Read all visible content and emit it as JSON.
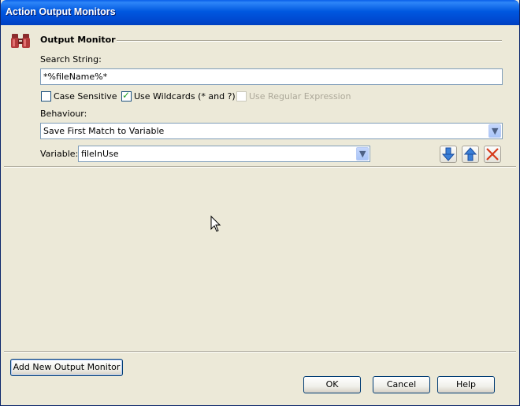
{
  "window": {
    "title": "Action Output Monitors",
    "titlebar_color": "#0054E3",
    "background": "#ECE9D8"
  },
  "section": {
    "title": "Output Monitor",
    "icon": "binoculars-icon"
  },
  "search": {
    "label": "Search String:",
    "value": "*%fileName%*"
  },
  "options": {
    "case_sensitive": {
      "label": "Case Sensitive",
      "checked": false
    },
    "use_wildcards": {
      "label": "Use Wildcards (* and ?)",
      "checked": true
    },
    "use_regex": {
      "label": "Use Regular Expression",
      "checked": false,
      "disabled": true
    }
  },
  "behaviour": {
    "label": "Behaviour:",
    "selected": "Save First Match to Variable"
  },
  "variable": {
    "label": "Variable:",
    "selected": "fileInUse"
  },
  "toolbar": {
    "move_down_icon": "arrow-down-icon",
    "move_up_icon": "arrow-up-icon",
    "delete_icon": "delete-x-icon"
  },
  "buttons": {
    "add_new": "Add New Output Monitor",
    "ok": "OK",
    "cancel": "Cancel",
    "help": "Help"
  }
}
